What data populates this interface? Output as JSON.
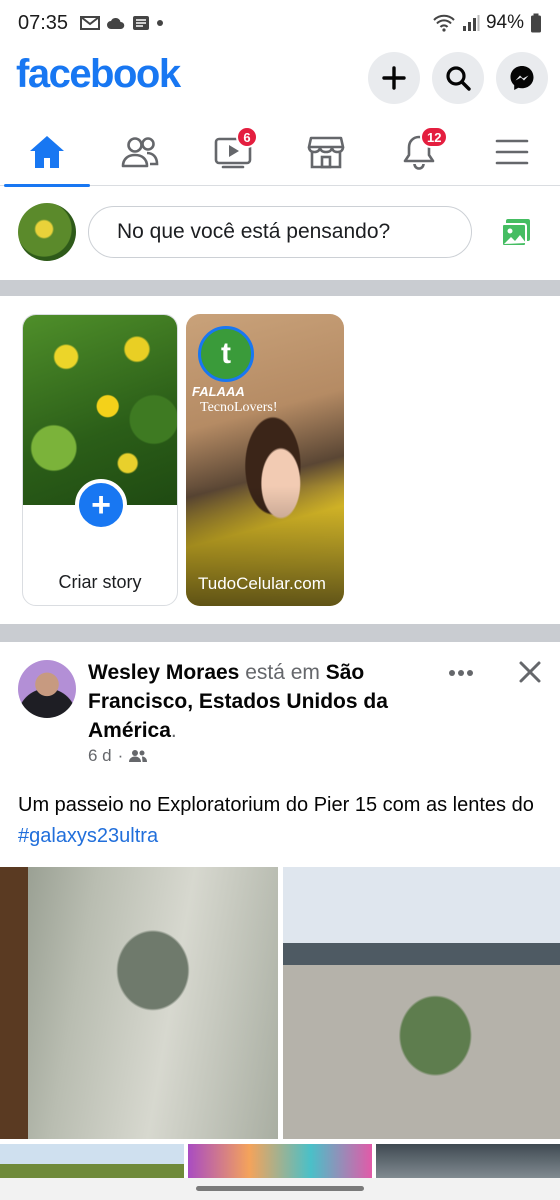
{
  "status_bar": {
    "time": "07:35",
    "battery": "94%",
    "left_icons": [
      "gmail-icon",
      "cloud-icon",
      "message-icon",
      "dot-icon"
    ],
    "right_icons": [
      "wifi-icon",
      "signal-icon",
      "battery-icon"
    ]
  },
  "header": {
    "logo": "facebook",
    "buttons": [
      "plus-icon",
      "search-icon",
      "messenger-icon"
    ]
  },
  "nav": {
    "tabs": [
      {
        "name": "home",
        "badge": ""
      },
      {
        "name": "friends",
        "badge": ""
      },
      {
        "name": "watch",
        "badge": "6"
      },
      {
        "name": "marketplace",
        "badge": ""
      },
      {
        "name": "notifications",
        "badge": "12"
      },
      {
        "name": "menu",
        "badge": ""
      }
    ],
    "active": "home"
  },
  "composer": {
    "placeholder": "No que você está pensando?"
  },
  "stories": {
    "create_label": "Criar story",
    "items": [
      {
        "caption1": "FALAAA",
        "caption2": "TecnoLovers!",
        "name": "TudoCelular.com",
        "logo_letter": "t"
      }
    ]
  },
  "post": {
    "author": "Wesley Moraes",
    "is_in": "está em",
    "location": "São Francisco, Estados Unidos da América",
    "period": ".",
    "time": "6 d",
    "separator": "·",
    "text_before": "Um passeio no Exploratorium do Pier 15 com as lentes do ",
    "hashtag": "#galaxys23ultra"
  },
  "colors": {
    "brand": "#1877f2",
    "badge": "#e41e3f",
    "hashtag": "#216fdb"
  }
}
